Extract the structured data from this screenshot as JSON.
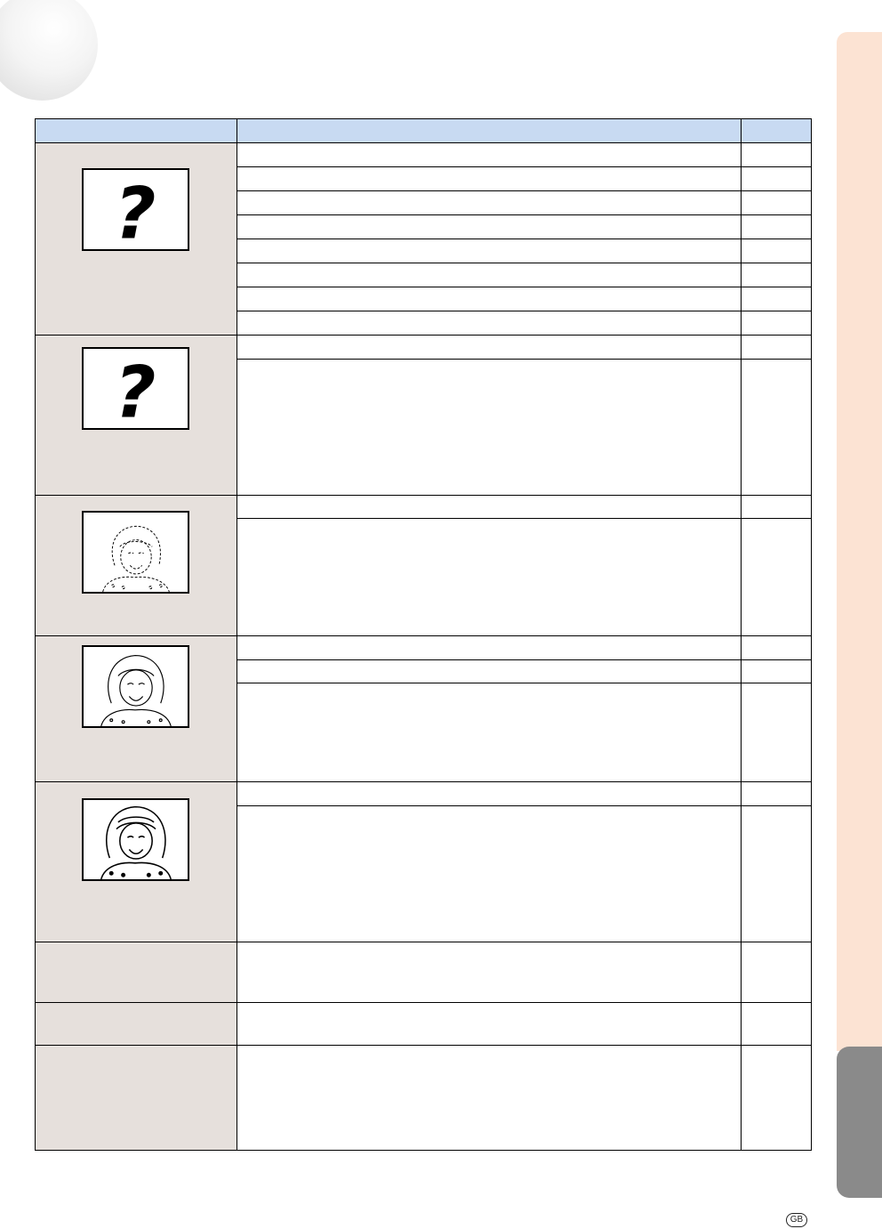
{
  "page": {
    "region_badge": "GB"
  },
  "table": {
    "header": [
      "",
      "",
      ""
    ],
    "groups": [
      {
        "image": "question-mark-image",
        "rows": 8
      },
      {
        "image": "question-mark-image",
        "rows": 2
      },
      {
        "image": "faded-portrait-image",
        "rows": 2
      },
      {
        "image": "light-portrait-image",
        "rows": 3
      },
      {
        "image": "clear-portrait-image",
        "rows": 2
      },
      {
        "image": "none",
        "rows": 1
      },
      {
        "image": "none",
        "rows": 1
      },
      {
        "image": "none",
        "rows": 1
      }
    ]
  }
}
